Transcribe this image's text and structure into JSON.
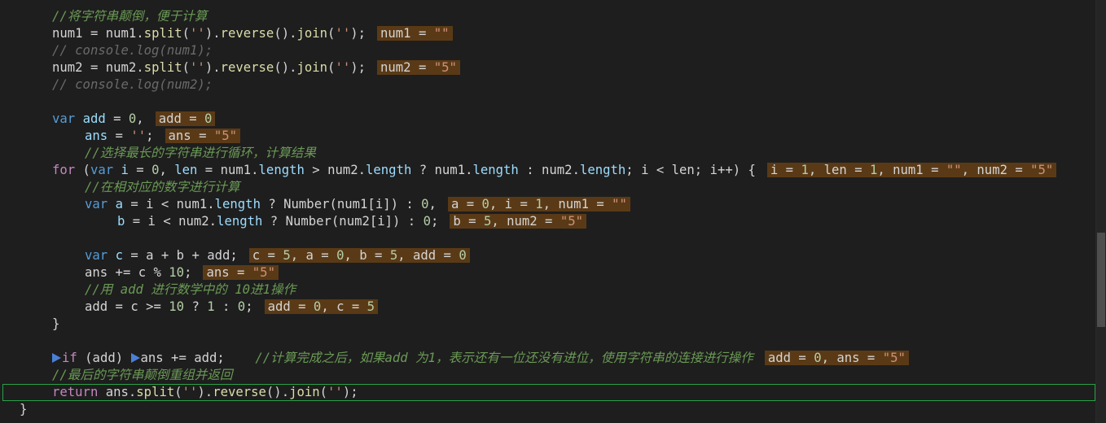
{
  "editor": {
    "lines": [
      {
        "indent": 64,
        "segs": [
          {
            "t": "//将字符串颠倒，便于计算",
            "c": "c-comment"
          }
        ]
      },
      {
        "indent": 64,
        "segs": [
          {
            "t": "num1",
            "c": "c-plain"
          },
          {
            "t": " = ",
            "c": "c-op"
          },
          {
            "t": "num1",
            "c": "c-plain"
          },
          {
            "t": ".",
            "c": "c-op"
          },
          {
            "t": "split",
            "c": "c-fn"
          },
          {
            "t": "(",
            "c": "c-op"
          },
          {
            "t": "''",
            "c": "c-str"
          },
          {
            "t": ").",
            "c": "c-op"
          },
          {
            "t": "reverse",
            "c": "c-fn"
          },
          {
            "t": "().",
            "c": "c-op"
          },
          {
            "t": "join",
            "c": "c-fn"
          },
          {
            "t": "(",
            "c": "c-op"
          },
          {
            "t": "''",
            "c": "c-str"
          },
          {
            "t": ");",
            "c": "c-op"
          }
        ],
        "hint": [
          {
            "t": "num1 = ",
            "k": "p"
          },
          {
            "t": "\"\"",
            "k": "s"
          }
        ]
      },
      {
        "indent": 64,
        "segs": [
          {
            "t": "// console.log(num1);",
            "c": "c-dim"
          }
        ]
      },
      {
        "indent": 64,
        "segs": [
          {
            "t": "num2",
            "c": "c-plain"
          },
          {
            "t": " = ",
            "c": "c-op"
          },
          {
            "t": "num2",
            "c": "c-plain"
          },
          {
            "t": ".",
            "c": "c-op"
          },
          {
            "t": "split",
            "c": "c-fn"
          },
          {
            "t": "(",
            "c": "c-op"
          },
          {
            "t": "''",
            "c": "c-str"
          },
          {
            "t": ").",
            "c": "c-op"
          },
          {
            "t": "reverse",
            "c": "c-fn"
          },
          {
            "t": "().",
            "c": "c-op"
          },
          {
            "t": "join",
            "c": "c-fn"
          },
          {
            "t": "(",
            "c": "c-op"
          },
          {
            "t": "''",
            "c": "c-str"
          },
          {
            "t": ");",
            "c": "c-op"
          }
        ],
        "hint": [
          {
            "t": "num2 = ",
            "k": "p"
          },
          {
            "t": "\"5\"",
            "k": "s"
          }
        ]
      },
      {
        "indent": 64,
        "segs": [
          {
            "t": "// console.log(num2);",
            "c": "c-dim"
          }
        ]
      },
      {
        "indent": 64,
        "segs": []
      },
      {
        "indent": 64,
        "segs": [
          {
            "t": "var",
            "c": "c-kw"
          },
          {
            "t": " ",
            "c": "c-plain"
          },
          {
            "t": "add",
            "c": "c-var"
          },
          {
            "t": " = ",
            "c": "c-op"
          },
          {
            "t": "0",
            "c": "c-num"
          },
          {
            "t": ",",
            "c": "c-op"
          }
        ],
        "hint": [
          {
            "t": "add = ",
            "k": "p"
          },
          {
            "t": "0",
            "k": "v"
          }
        ]
      },
      {
        "indent": 104,
        "segs": [
          {
            "t": "ans",
            "c": "c-var"
          },
          {
            "t": " = ",
            "c": "c-op"
          },
          {
            "t": "''",
            "c": "c-str"
          },
          {
            "t": ";",
            "c": "c-op"
          }
        ],
        "hint": [
          {
            "t": "ans = ",
            "k": "p"
          },
          {
            "t": "\"5\"",
            "k": "s"
          }
        ]
      },
      {
        "indent": 104,
        "segs": [
          {
            "t": "//选择最长的字符串进行循环，计算结果",
            "c": "c-comment"
          }
        ]
      },
      {
        "indent": 64,
        "segs": [
          {
            "t": "for",
            "c": "c-ctrl"
          },
          {
            "t": " (",
            "c": "c-op"
          },
          {
            "t": "var",
            "c": "c-kw"
          },
          {
            "t": " ",
            "c": "c-plain"
          },
          {
            "t": "i",
            "c": "c-var"
          },
          {
            "t": " = ",
            "c": "c-op"
          },
          {
            "t": "0",
            "c": "c-num"
          },
          {
            "t": ", ",
            "c": "c-op"
          },
          {
            "t": "len",
            "c": "c-var"
          },
          {
            "t": " = ",
            "c": "c-op"
          },
          {
            "t": "num1",
            "c": "c-plain"
          },
          {
            "t": ".",
            "c": "c-op"
          },
          {
            "t": "length",
            "c": "c-var"
          },
          {
            "t": " > ",
            "c": "c-op"
          },
          {
            "t": "num2",
            "c": "c-plain"
          },
          {
            "t": ".",
            "c": "c-op"
          },
          {
            "t": "length",
            "c": "c-var"
          },
          {
            "t": " ? ",
            "c": "c-op"
          },
          {
            "t": "num1",
            "c": "c-plain"
          },
          {
            "t": ".",
            "c": "c-op"
          },
          {
            "t": "length",
            "c": "c-var"
          },
          {
            "t": " : ",
            "c": "c-op"
          },
          {
            "t": "num2",
            "c": "c-plain"
          },
          {
            "t": ".",
            "c": "c-op"
          },
          {
            "t": "length",
            "c": "c-var"
          },
          {
            "t": "; i < len; i++) {",
            "c": "c-plain"
          }
        ],
        "hint": [
          {
            "t": "i = ",
            "k": "p"
          },
          {
            "t": "1",
            "k": "v"
          },
          {
            "t": ", len = ",
            "k": "p"
          },
          {
            "t": "1",
            "k": "v"
          },
          {
            "t": ", num1 = ",
            "k": "p"
          },
          {
            "t": "\"\"",
            "k": "s"
          },
          {
            "t": ", num2 = ",
            "k": "p"
          },
          {
            "t": "\"5\"",
            "k": "s"
          }
        ]
      },
      {
        "indent": 104,
        "segs": [
          {
            "t": "//在相对应的数字进行计算",
            "c": "c-comment"
          }
        ]
      },
      {
        "indent": 104,
        "segs": [
          {
            "t": "var",
            "c": "c-kw"
          },
          {
            "t": " ",
            "c": "c-plain"
          },
          {
            "t": "a",
            "c": "c-var"
          },
          {
            "t": " = i < num1.",
            "c": "c-op"
          },
          {
            "t": "length",
            "c": "c-var"
          },
          {
            "t": " ? ",
            "c": "c-op"
          },
          {
            "t": "Number",
            "c": "c-plain"
          },
          {
            "t": "(num1[i]) : ",
            "c": "c-plain"
          },
          {
            "t": "0",
            "c": "c-num"
          },
          {
            "t": ",",
            "c": "c-op"
          }
        ],
        "hint": [
          {
            "t": "a = ",
            "k": "p"
          },
          {
            "t": "0",
            "k": "v"
          },
          {
            "t": ", i = ",
            "k": "p"
          },
          {
            "t": "1",
            "k": "v"
          },
          {
            "t": ", num1 = ",
            "k": "p"
          },
          {
            "t": "\"\"",
            "k": "s"
          }
        ]
      },
      {
        "indent": 144,
        "segs": [
          {
            "t": "b",
            "c": "c-var"
          },
          {
            "t": " = i < num2.",
            "c": "c-op"
          },
          {
            "t": "length",
            "c": "c-var"
          },
          {
            "t": " ? ",
            "c": "c-op"
          },
          {
            "t": "Number",
            "c": "c-plain"
          },
          {
            "t": "(num2[i]) : ",
            "c": "c-plain"
          },
          {
            "t": "0",
            "c": "c-num"
          },
          {
            "t": ";",
            "c": "c-op"
          }
        ],
        "hint": [
          {
            "t": "b = ",
            "k": "p"
          },
          {
            "t": "5",
            "k": "v"
          },
          {
            "t": ", num2 = ",
            "k": "p"
          },
          {
            "t": "\"5\"",
            "k": "s"
          }
        ]
      },
      {
        "indent": 104,
        "segs": []
      },
      {
        "indent": 104,
        "segs": [
          {
            "t": "var",
            "c": "c-kw"
          },
          {
            "t": " ",
            "c": "c-plain"
          },
          {
            "t": "c",
            "c": "c-var"
          },
          {
            "t": " = a + b + add;",
            "c": "c-op"
          }
        ],
        "hint": [
          {
            "t": "c = ",
            "k": "p"
          },
          {
            "t": "5",
            "k": "v"
          },
          {
            "t": ", a = ",
            "k": "p"
          },
          {
            "t": "0",
            "k": "v"
          },
          {
            "t": ", b = ",
            "k": "p"
          },
          {
            "t": "5",
            "k": "v"
          },
          {
            "t": ", add = ",
            "k": "p"
          },
          {
            "t": "0",
            "k": "v"
          }
        ]
      },
      {
        "indent": 104,
        "segs": [
          {
            "t": "ans",
            "c": "c-plain"
          },
          {
            "t": " += c % ",
            "c": "c-op"
          },
          {
            "t": "10",
            "c": "c-num"
          },
          {
            "t": ";",
            "c": "c-op"
          }
        ],
        "hint": [
          {
            "t": "ans = ",
            "k": "p"
          },
          {
            "t": "\"5\"",
            "k": "s"
          }
        ]
      },
      {
        "indent": 104,
        "segs": [
          {
            "t": "//用 add 进行数学中的 10进1操作",
            "c": "c-comment"
          }
        ]
      },
      {
        "indent": 104,
        "segs": [
          {
            "t": "add",
            "c": "c-plain"
          },
          {
            "t": " = c >= ",
            "c": "c-op"
          },
          {
            "t": "10",
            "c": "c-num"
          },
          {
            "t": " ? ",
            "c": "c-op"
          },
          {
            "t": "1",
            "c": "c-num"
          },
          {
            "t": " : ",
            "c": "c-op"
          },
          {
            "t": "0",
            "c": "c-num"
          },
          {
            "t": ";",
            "c": "c-op"
          }
        ],
        "hint": [
          {
            "t": "add = ",
            "k": "p"
          },
          {
            "t": "0",
            "k": "v"
          },
          {
            "t": ", c = ",
            "k": "p"
          },
          {
            "t": "5",
            "k": "v"
          }
        ]
      },
      {
        "indent": 64,
        "segs": [
          {
            "t": "}",
            "c": "c-plain"
          }
        ]
      },
      {
        "indent": 64,
        "segs": []
      },
      {
        "indent": 64,
        "bp": true,
        "segs": [
          {
            "t": "if",
            "c": "c-ctrl"
          },
          {
            "t": " (add) ",
            "c": "c-plain"
          },
          {
            "t": "BP",
            "c": "bp"
          },
          {
            "t": "ans += add;",
            "c": "c-plain"
          },
          {
            "t": "    //计算完成之后，如果add 为1，表示还有一位还没有进位，使用字符串的连接进行操作",
            "c": "c-comment"
          }
        ],
        "hint": [
          {
            "t": "add = ",
            "k": "p"
          },
          {
            "t": "0",
            "k": "v"
          },
          {
            "t": ", ans = ",
            "k": "p"
          },
          {
            "t": "\"5\"",
            "k": "s"
          }
        ]
      },
      {
        "indent": 64,
        "segs": [
          {
            "t": "//最后的字符串颠倒重组并返回",
            "c": "c-comment"
          }
        ]
      },
      {
        "indent": 64,
        "current": true,
        "segs": [
          {
            "t": "return",
            "c": "c-ctrl"
          },
          {
            "t": " ",
            "c": "c-plain"
          },
          {
            "t": "ans",
            "c": "c-plain"
          },
          {
            "t": ".",
            "c": "c-op"
          },
          {
            "t": "split",
            "c": "c-fn"
          },
          {
            "t": "(",
            "c": "c-op"
          },
          {
            "t": "''",
            "c": "c-str"
          },
          {
            "t": ").",
            "c": "c-op"
          },
          {
            "t": "reverse",
            "c": "c-fn"
          },
          {
            "t": "().",
            "c": "c-op"
          },
          {
            "t": "join",
            "c": "c-fn"
          },
          {
            "t": "(",
            "c": "c-op"
          },
          {
            "t": "''",
            "c": "c-str"
          },
          {
            "t": ");",
            "c": "c-op"
          }
        ]
      },
      {
        "indent": 24,
        "segs": [
          {
            "t": "}",
            "c": "c-plain"
          }
        ]
      }
    ]
  },
  "colors": {
    "background": "#1e1e1e",
    "hint_background": "#5a3a16",
    "current_line_border": "#2aa048",
    "breakpoint": "#4a7fd6"
  }
}
